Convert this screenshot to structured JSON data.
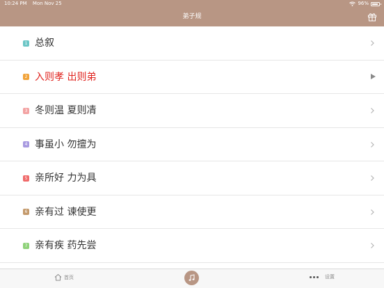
{
  "status_bar": {
    "time": "10:24 PM",
    "date": "Mon Nov 25",
    "battery": "96%"
  },
  "nav": {
    "title": "弟子规",
    "action_icon": "gift-icon"
  },
  "colors": {
    "accent": "#b89684",
    "active_text": "#e0231e"
  },
  "chapters": [
    {
      "num": "1",
      "label": "总叙",
      "color": "#6cc6c6",
      "active": false
    },
    {
      "num": "2",
      "label": "入则孝 出则弟",
      "color": "#f1a33a",
      "active": true
    },
    {
      "num": "3",
      "label": "冬则温 夏则凊",
      "color": "#f3a3a3",
      "active": false
    },
    {
      "num": "4",
      "label": "事虽小 勿擅为",
      "color": "#a89ae0",
      "active": false
    },
    {
      "num": "5",
      "label": "亲所好 力为具",
      "color": "#f06b6b",
      "active": false
    },
    {
      "num": "6",
      "label": "亲有过 谏使更",
      "color": "#c49a6c",
      "active": false
    },
    {
      "num": "7",
      "label": "亲有疾 药先尝",
      "color": "#8fd27a",
      "active": false
    }
  ],
  "tabbar": {
    "home": {
      "label": "首页",
      "icon": "home-icon"
    },
    "music": {
      "icon": "music-note-icon"
    },
    "settings": {
      "label": "设置",
      "icon": "more-dots-icon"
    }
  }
}
